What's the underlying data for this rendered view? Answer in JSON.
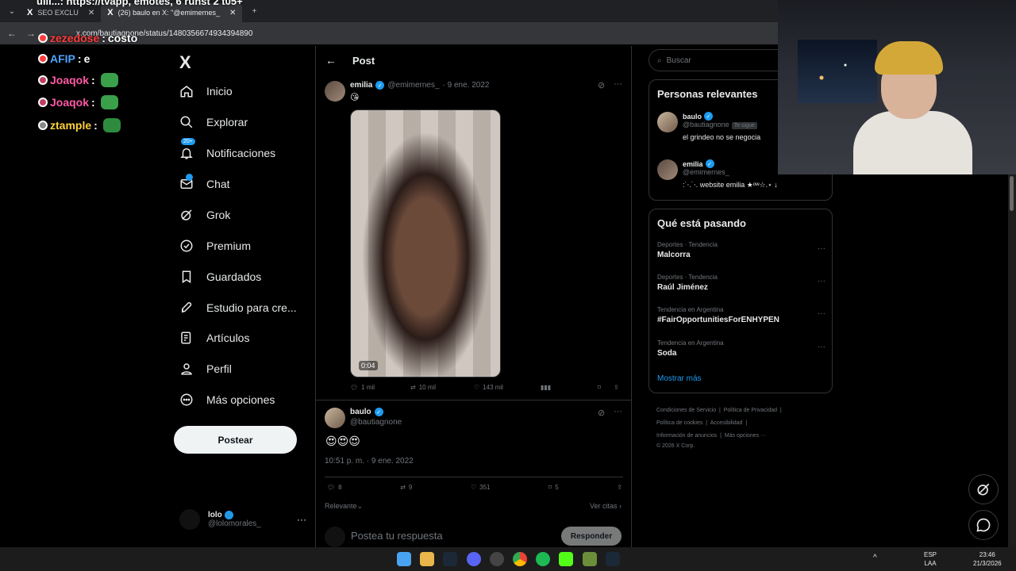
{
  "browser": {
    "tabs": [
      {
        "title": "SEO EXCLU",
        "active": false
      },
      {
        "title": "(26) baulo en X: \"@emimernes_",
        "active": true
      }
    ],
    "new_tab": "+",
    "url": "x.com/bautiagnone/status/1480356674934394890"
  },
  "overlay_chat": [
    {
      "user": "zezedose",
      "message": "costo",
      "color": "#ff3b3b"
    },
    {
      "user": "AFIP",
      "message": "e",
      "color": "#4fa3ff"
    },
    {
      "user": "Joaqok",
      "message": "",
      "color": "#ff5aa5"
    },
    {
      "user": "Joaqok",
      "message": "",
      "color": "#ff5aa5"
    },
    {
      "user": "ztample",
      "message": "",
      "color": "#ffd23a"
    }
  ],
  "overlay_top": "ulli...: https://tvapp, emotes, 6 runst 2 t05+",
  "nav": {
    "logo": "X",
    "items": [
      {
        "label": "Inicio",
        "icon": "home-icon"
      },
      {
        "label": "Explorar",
        "icon": "search-icon"
      },
      {
        "label": "Notificaciones",
        "icon": "bell-icon",
        "badge": "20+"
      },
      {
        "label": "Chat",
        "icon": "mail-icon"
      },
      {
        "label": "Grok",
        "icon": "grok-icon"
      },
      {
        "label": "Premium",
        "icon": "verified-icon"
      },
      {
        "label": "Guardados",
        "icon": "bookmark-icon"
      },
      {
        "label": "Estudio para cre...",
        "icon": "rocket-icon"
      },
      {
        "label": "Artículos",
        "icon": "article-icon"
      },
      {
        "label": "Perfil",
        "icon": "person-icon"
      },
      {
        "label": "Más opciones",
        "icon": "more-circle-icon"
      }
    ],
    "post_button": "Postear",
    "account": {
      "name": "lolo",
      "handle": "@lolomorales_"
    }
  },
  "main": {
    "header": "Post",
    "quoted_tweet": {
      "name": "emilia",
      "handle": "@emimernes_",
      "date": "· 9 ene. 2022",
      "emoji": "😘",
      "video_duration": "0:04",
      "replies": "1 mil",
      "retweets": "10 mil",
      "likes": "143 mil"
    },
    "tweet": {
      "name": "baulo",
      "handle": "@bautiagnone",
      "text": "😍😍😍",
      "timestamp": "10:51 p. m. · 9 ene. 2022",
      "replies": "8",
      "retweets": "9",
      "likes": "351",
      "bookmarks": "5"
    },
    "sort_label": "Relevante",
    "quotes_link": "Ver citas",
    "reply_placeholder": "Postea tu respuesta",
    "reply_button": "Responder"
  },
  "right": {
    "search_placeholder": "Buscar",
    "relevant_title": "Personas relevantes",
    "people": [
      {
        "name": "baulo",
        "handle": "@bautiagnone",
        "follows_you": "Te sigue",
        "bio": "el grindeo no se negocia"
      },
      {
        "name": "emilia",
        "handle": "@emimernes_",
        "bio": ":˙⋅.˙⋅. website emilia ★ᵒʷ☆.⋆ ↓"
      }
    ],
    "trending_title": "Qué está pasando",
    "trends": [
      {
        "context": "Deportes · Tendencia",
        "name": "Malcorra"
      },
      {
        "context": "Deportes · Tendencia",
        "name": "Raúl Jiménez"
      },
      {
        "context": "Tendencia en Argentina",
        "name": "#FairOpportunitiesForENHYPEN"
      },
      {
        "context": "Tendencia en Argentina",
        "name": "Soda"
      }
    ],
    "show_more": "Mostrar más",
    "footer": {
      "line1": [
        "Condiciones de Servicio",
        "Política de Privacidad"
      ],
      "line2": [
        "Política de cookies",
        "Accesibilidad"
      ],
      "line3": [
        "Información de anuncios",
        "Más opciones ···"
      ],
      "copyright": "© 2026 X Corp."
    }
  },
  "taskbar": {
    "lang_top": "ESP",
    "lang_bottom": "LAA",
    "time": "23:46",
    "date": "21/3/2026"
  },
  "colors": {
    "accent": "#1d9bf0",
    "background": "#000000"
  }
}
